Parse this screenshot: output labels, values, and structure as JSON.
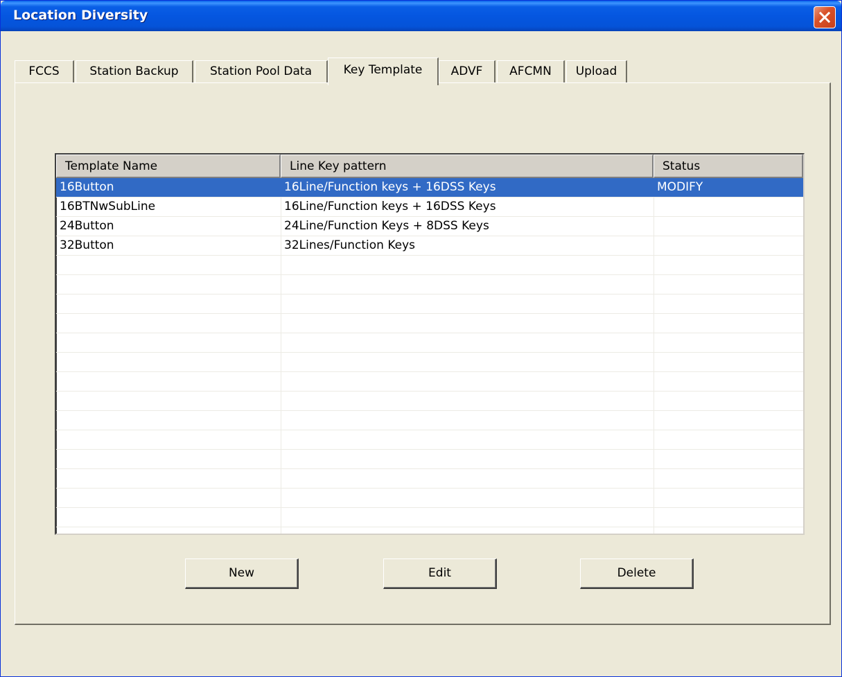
{
  "window": {
    "title": "Location Diversity"
  },
  "tabs": [
    {
      "label": "FCCS",
      "active": false
    },
    {
      "label": "Station Backup",
      "active": false
    },
    {
      "label": "Station Pool Data",
      "active": false
    },
    {
      "label": "Key Template",
      "active": true
    },
    {
      "label": "ADVF",
      "active": false
    },
    {
      "label": "AFCMN",
      "active": false
    },
    {
      "label": "Upload",
      "active": false
    }
  ],
  "list": {
    "columns": [
      "Template Name",
      "Line Key pattern",
      "Status"
    ],
    "rows": [
      {
        "name": "16Button",
        "pattern": "16Line/Function keys + 16DSS Keys",
        "status": "MODIFY",
        "selected": true
      },
      {
        "name": "16BTNwSubLine",
        "pattern": "16Line/Function keys + 16DSS Keys",
        "status": "",
        "selected": false
      },
      {
        "name": "24Button",
        "pattern": "24Line/Function Keys + 8DSS Keys",
        "status": "",
        "selected": false
      },
      {
        "name": "32Button",
        "pattern": "32Lines/Function Keys",
        "status": "",
        "selected": false
      }
    ]
  },
  "buttons": {
    "new": "New",
    "edit": "Edit",
    "delete": "Delete"
  },
  "icons": {
    "close": "close-icon"
  },
  "colors": {
    "selection": "#316ac5",
    "titlebar": "#0556e0"
  }
}
